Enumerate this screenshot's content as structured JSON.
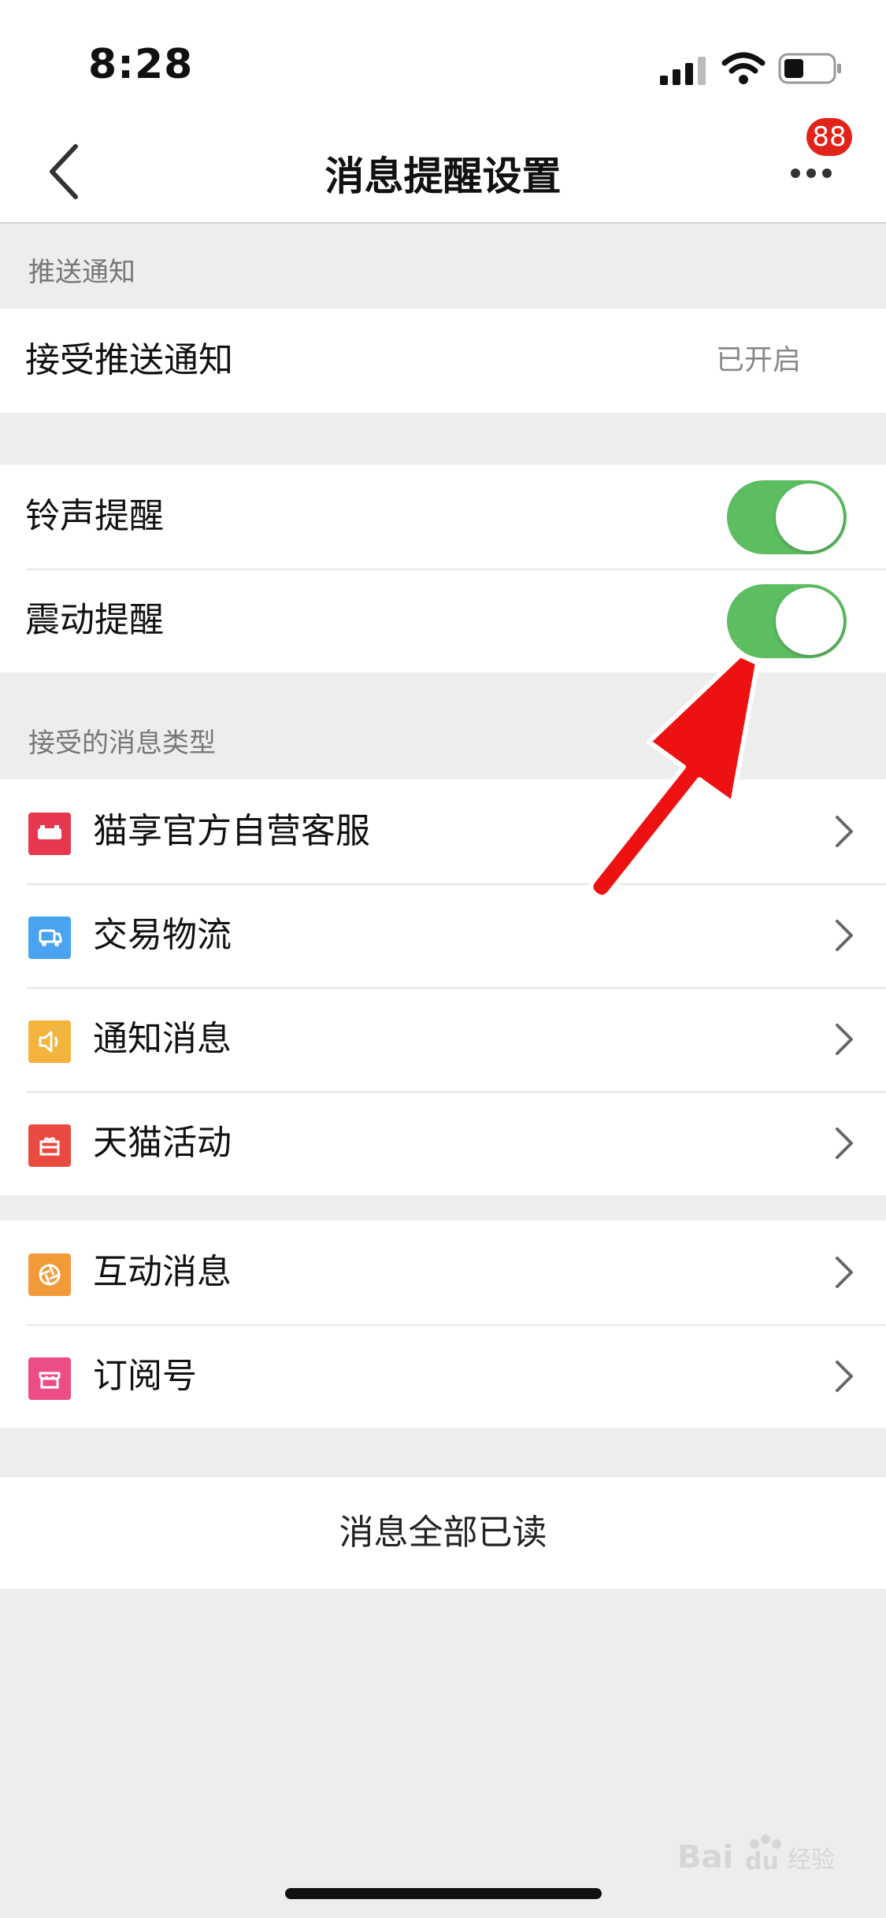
{
  "status_bar": {
    "time": "8:28"
  },
  "nav": {
    "title": "消息提醒设置",
    "badge_count": "88"
  },
  "sections": {
    "push": {
      "header": "推送通知",
      "accept_push_label": "接受推送通知",
      "accept_push_value": "已开启"
    },
    "alerts": {
      "ringtone_label": "铃声提醒",
      "ringtone_on": true,
      "vibration_label": "震动提醒",
      "vibration_on": true
    },
    "types": {
      "header": "接受的消息类型",
      "items": [
        {
          "label": "猫享官方自营客服",
          "icon": "store-icon",
          "color": "#e8384f"
        },
        {
          "label": "交易物流",
          "icon": "truck-icon",
          "color": "#4aa3f0"
        },
        {
          "label": "通知消息",
          "icon": "speaker-icon",
          "color": "#f3b33d"
        },
        {
          "label": "天猫活动",
          "icon": "gift-icon",
          "color": "#e94b40"
        }
      ],
      "items2": [
        {
          "label": "互动消息",
          "icon": "aperture-icon",
          "color": "#f29a3a"
        },
        {
          "label": "订阅号",
          "icon": "shop-icon",
          "color": "#ec4d86"
        }
      ]
    }
  },
  "actions": {
    "mark_all_read": "消息全部已读"
  },
  "colors": {
    "toggle_on": "#5cbd61",
    "badge": "#e2231a",
    "arrow": "#ee1111"
  }
}
